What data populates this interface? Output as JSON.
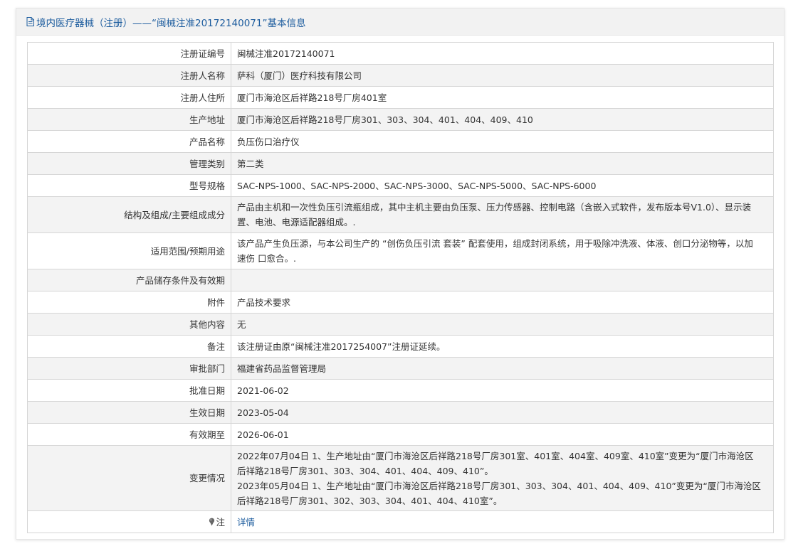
{
  "header": {
    "title": "境内医疗器械（注册）——“闽械注准20172140071”基本信息"
  },
  "rows": [
    {
      "label": "注册证编号",
      "value": "闽械注准20172140071"
    },
    {
      "label": "注册人名称",
      "value": "萨科（厦门）医疗科技有限公司"
    },
    {
      "label": "注册人住所",
      "value": "厦门市海沧区后祥路218号厂房401室"
    },
    {
      "label": "生产地址",
      "value": "厦门市海沧区后祥路218号厂房301、303、304、401、404、409、410"
    },
    {
      "label": "产品名称",
      "value": "负压伤口治疗仪"
    },
    {
      "label": "管理类别",
      "value": "第二类"
    },
    {
      "label": "型号规格",
      "value": "SAC-NPS-1000、SAC-NPS-2000、SAC-NPS-3000、SAC-NPS-5000、SAC-NPS-6000"
    },
    {
      "label": "结构及组成/主要组成成分",
      "value_lines": [
        "产品由主机和一次性负压引流瓶组成，其中主机主要由负压泵、压力传感器、控制电路（含嵌入式软件，发布版本号V1.0）、显示装",
        "置、电池、电源适配器组成。."
      ]
    },
    {
      "label": "适用范围/预期用途",
      "value_lines": [
        "该产品产生负压源，与本公司生产的 “创伤负压引流 套装” 配套使用，组成封闭系统，用于吸除冲洗液、体液、创口分泌物等，以加",
        "速伤 口愈合。."
      ]
    },
    {
      "label": "产品储存条件及有效期",
      "value": ""
    },
    {
      "label": "附件",
      "value": "产品技术要求"
    },
    {
      "label": "其他内容",
      "value": "无"
    },
    {
      "label": "备注",
      "value": "该注册证由原“闽械注准2017254007”注册证延续。"
    },
    {
      "label": "审批部门",
      "value": "福建省药品监督管理局"
    },
    {
      "label": "批准日期",
      "value": "2021-06-02"
    },
    {
      "label": "生效日期",
      "value": "2023-05-04"
    },
    {
      "label": "有效期至",
      "value": "2026-06-01"
    },
    {
      "label": "变更情况",
      "value_lines": [
        "2022年07月04日 1、生产地址由“厦门市海沧区后祥路218号厂房301室、401室、404室、409室、410室”变更为“厦门市海沧区",
        "后祥路218号厂房301、303、304、401、404、409、410”。",
        "2023年05月04日 1、生产地址由“厦门市海沧区后祥路218号厂房301、303、304、401、404、409、410”变更为“厦门市海沧区",
        "后祥路218号厂房301、302、303、304、401、404、410室”。"
      ]
    }
  ],
  "note": {
    "label": "注",
    "link": "详情",
    "icon": "pin-icon"
  },
  "colors": {
    "link": "#1c5c9e",
    "header_bg": "#f2f2f2",
    "row_alt": "#f3f3f3",
    "border": "#d6d6d6"
  }
}
